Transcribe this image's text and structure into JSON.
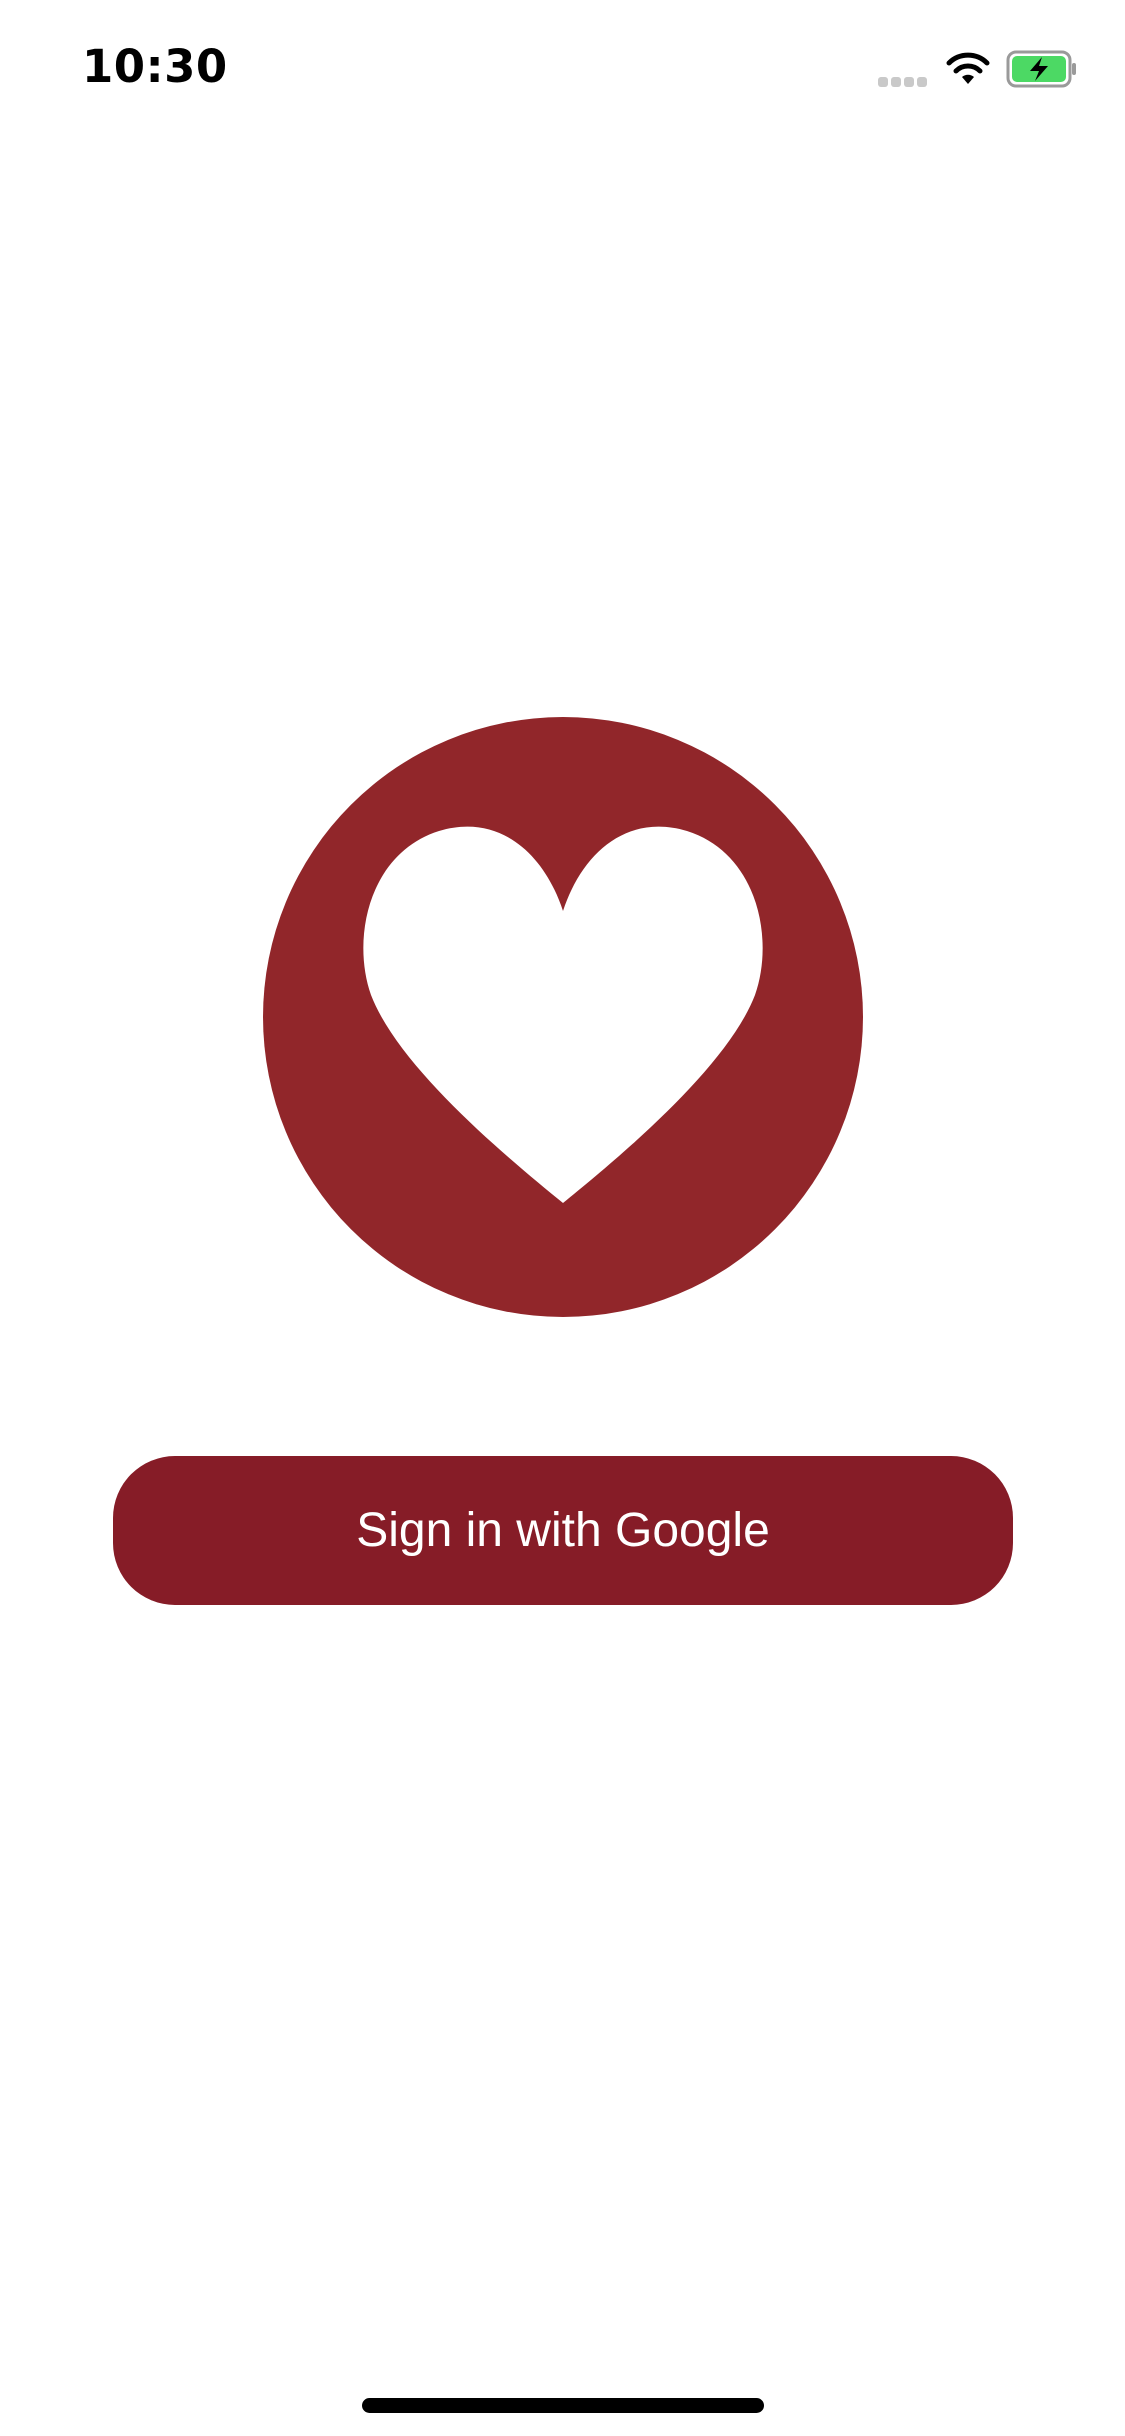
{
  "status_bar": {
    "time": "10:30",
    "signal_icon": "cellular-signal-icon",
    "wifi_icon": "wifi-icon",
    "battery_icon": "battery-charging-icon"
  },
  "logo": {
    "icon": "heart-icon",
    "circle_color": "#91262a",
    "heart_color": "#ffffff"
  },
  "signin": {
    "label": "Sign in with Google",
    "color": "#861c27",
    "text_color": "#ffffff"
  },
  "colors": {
    "background": "#ffffff",
    "battery_fill": "#4cd964"
  }
}
